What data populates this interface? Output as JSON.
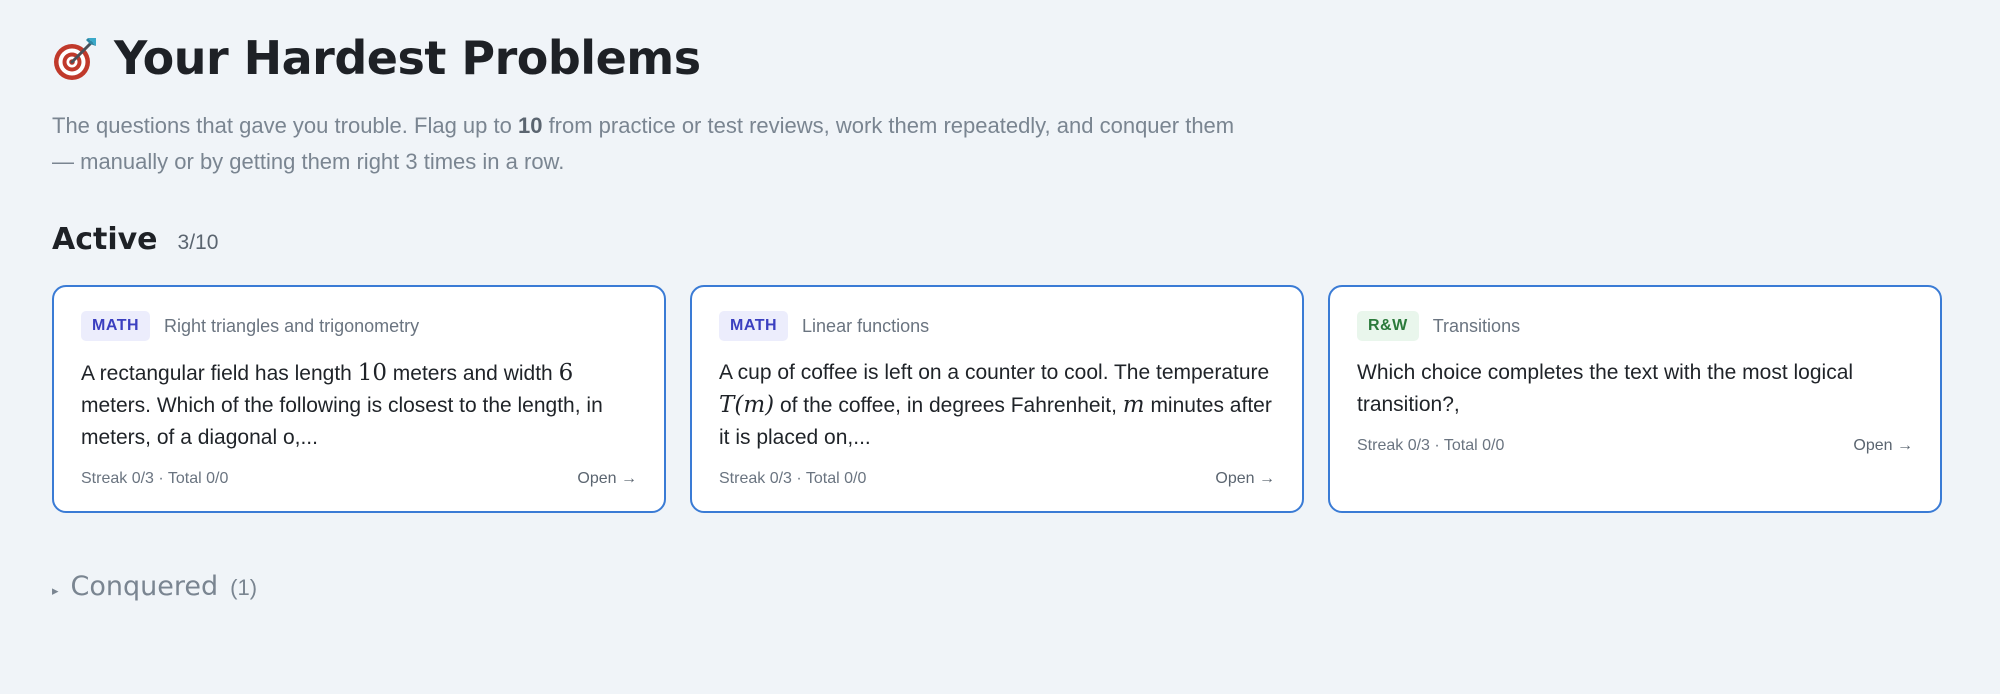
{
  "header": {
    "title": "Your Hardest Problems",
    "icon": "target-dart-icon",
    "subtitle_before": "The questions that gave you trouble. Flag up to ",
    "subtitle_bold": "10",
    "subtitle_after": " from practice or test reviews, work them repeatedly, and conquer them — manually or by getting them right 3 times in a row."
  },
  "active": {
    "title": "Active",
    "count": "3/10"
  },
  "cards": [
    {
      "badge": "MATH",
      "topic": "Right triangles and trigonometry",
      "q": {
        "t1": "A rectangular field has length ",
        "n1": "10",
        "t2": " meters and width ",
        "n2": "6",
        "t3": " meters. Which of the following is closest to the length, in meters, of a diagonal o,..."
      },
      "stats": "Streak 0/3 · Total 0/0",
      "open": "Open →"
    },
    {
      "badge": "MATH",
      "topic": "Linear functions",
      "q": {
        "t1": "A cup of coffee is left on a counter to cool. The temperature ",
        "m1": "T(m)",
        "t2": " of the coffee, in degrees Fahrenheit, ",
        "m2": "m",
        "t3": " minutes after it is placed on,..."
      },
      "stats": "Streak 0/3 · Total 0/0",
      "open": "Open →"
    },
    {
      "badge": "R&W",
      "topic": "Transitions",
      "q": {
        "t1": "Which choice completes the text with the most logical transition?,"
      },
      "stats": "Streak 0/3 · Total 0/0",
      "open": "Open →"
    }
  ],
  "conquered": {
    "label": "Conquered",
    "count": "(1)",
    "caret": "▸"
  },
  "colors": {
    "background": "#f0f4f8",
    "card_border": "#3a7bd5",
    "math_badge_bg": "#ecedfc",
    "math_badge_text": "#3b3fc0",
    "rw_badge_bg": "#e9f6ec",
    "rw_badge_text": "#2b7a3b"
  }
}
